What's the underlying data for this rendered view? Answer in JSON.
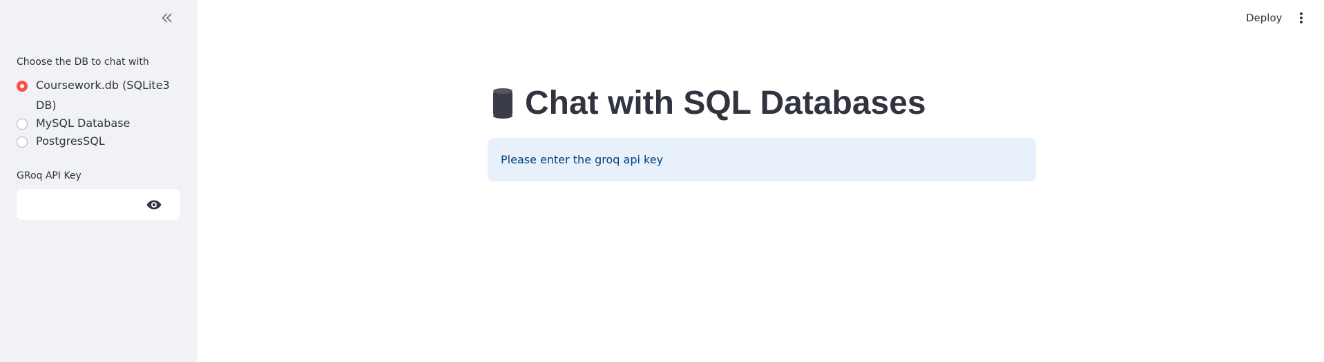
{
  "sidebar": {
    "collapse_icon": "double-chevron-left-icon",
    "db_choice_label": "Choose the DB to chat with",
    "db_options": [
      {
        "label": "Coursework.db (SQLite3 DB)",
        "selected": true
      },
      {
        "label": "MySQL Database",
        "selected": false
      },
      {
        "label": "PostgresSQL",
        "selected": false
      }
    ],
    "api_key_label": "GRoq API Key",
    "api_key_value": "",
    "show_password_icon": "eye-icon"
  },
  "header": {
    "deploy_label": "Deploy",
    "menu_icon": "vertical-ellipsis-icon"
  },
  "main": {
    "title_icon": "database-cylinder-icon",
    "title": "Chat with SQL Databases",
    "info_message": "Please enter the groq api key"
  },
  "colors": {
    "sidebar_bg": "#f0f2f6",
    "accent": "#ff4b4b",
    "info_bg": "#e8f1fb",
    "info_text": "#004280",
    "text": "#31333f"
  }
}
